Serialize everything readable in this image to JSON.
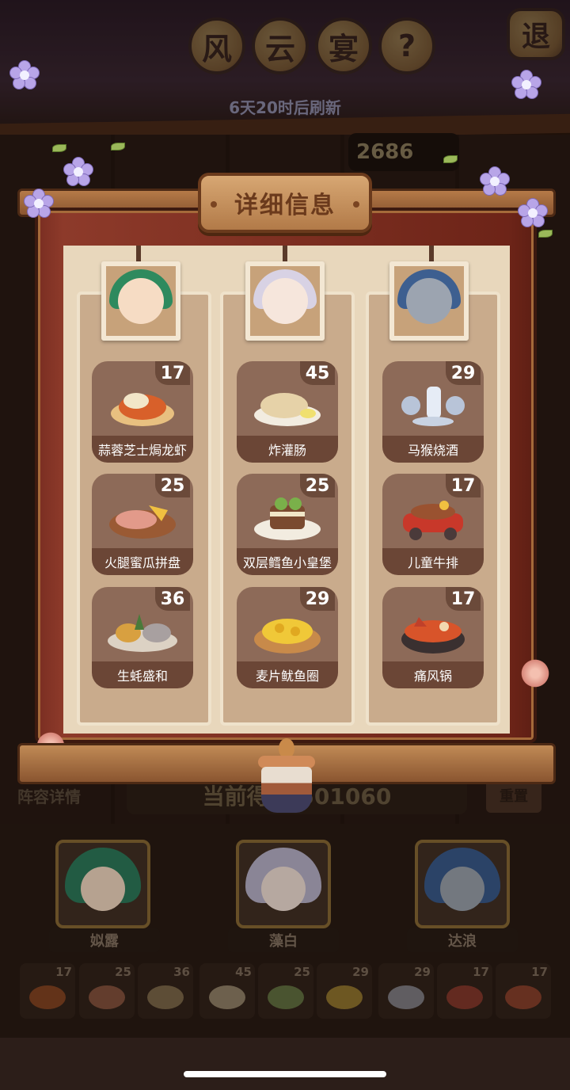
{
  "header": {
    "title_chars": [
      "风",
      "云",
      "宴"
    ],
    "help_symbol": "?",
    "exit_label": "退",
    "refresh_text": "6天20时后刷新",
    "top_score_partial": "2686"
  },
  "modal": {
    "title": "详细信息",
    "columns": [
      {
        "portrait_icon": "green-haired-girl-portrait",
        "dishes": [
          {
            "name": "蒜蓉芝士焗龙虾",
            "count": "17",
            "icon": "lobster-dish-icon"
          },
          {
            "name": "火腿蜜瓜拼盘",
            "count": "25",
            "icon": "ham-melon-platter-icon"
          },
          {
            "name": "生蚝盛和",
            "count": "36",
            "icon": "oyster-platter-icon"
          }
        ]
      },
      {
        "portrait_icon": "white-haired-girl-portrait",
        "dishes": [
          {
            "name": "炸灌肠",
            "count": "45",
            "icon": "fried-sausage-icon"
          },
          {
            "name": "双层鳕鱼小皇堡",
            "count": "25",
            "icon": "cod-burger-icon"
          },
          {
            "name": "麦片鱿鱼圈",
            "count": "29",
            "icon": "squid-rings-icon"
          }
        ]
      },
      {
        "portrait_icon": "wolf-officer-portrait",
        "dishes": [
          {
            "name": "马猴烧酒",
            "count": "29",
            "icon": "monkey-wine-set-icon"
          },
          {
            "name": "儿童牛排",
            "count": "17",
            "icon": "kids-steak-car-icon"
          },
          {
            "name": "痛风锅",
            "count": "17",
            "icon": "hotpot-icon"
          }
        ]
      }
    ]
  },
  "lower": {
    "lineup_label": "阵容详情",
    "score_text": "当前得分  501060",
    "reset_label": "重置",
    "characters": [
      {
        "name": "姒露",
        "icon": "green-haired-girl-avatar"
      },
      {
        "name": "藻白",
        "icon": "white-haired-girl-avatar"
      },
      {
        "name": "达浪",
        "icon": "wolf-officer-avatar"
      }
    ],
    "slots": [
      "17",
      "25",
      "36",
      "45",
      "25",
      "29",
      "29",
      "17",
      "17"
    ]
  },
  "colors": {
    "frame_red": "#7a2e22",
    "parchment": "#e8d7bc",
    "card_bg": "#8d6a58",
    "card_label_bg": "#6b4636",
    "title_bg": "#d7a773"
  }
}
